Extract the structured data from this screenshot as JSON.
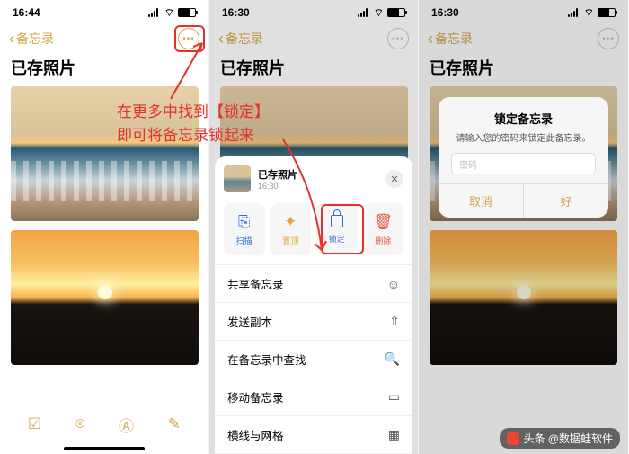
{
  "phones": {
    "p1": {
      "time": "16:44"
    },
    "p2": {
      "time": "16:30"
    },
    "p3": {
      "time": "16:30"
    }
  },
  "nav": {
    "back": "备忘录"
  },
  "note": {
    "title": "已存照片"
  },
  "annotation": {
    "line1": "在更多中找到【锁定】",
    "line2": "即可将备忘录锁起来"
  },
  "sheet": {
    "header_title": "已存照片",
    "header_sub": "16:30",
    "actions": {
      "scan": "扫描",
      "pin": "置顶",
      "lock": "锁定",
      "delete": "删除"
    },
    "rows": {
      "share": "共享备忘录",
      "send": "发送副本",
      "find": "在备忘录中查找",
      "move": "移动备忘录",
      "lines": "横线与网格"
    }
  },
  "dialog": {
    "title": "锁定备忘录",
    "subtitle": "请输入您的密码来锁定此备忘录。",
    "placeholder": "密码",
    "cancel": "取消",
    "ok": "好"
  },
  "footer": {
    "text": "头条 @数据蛙软件"
  }
}
